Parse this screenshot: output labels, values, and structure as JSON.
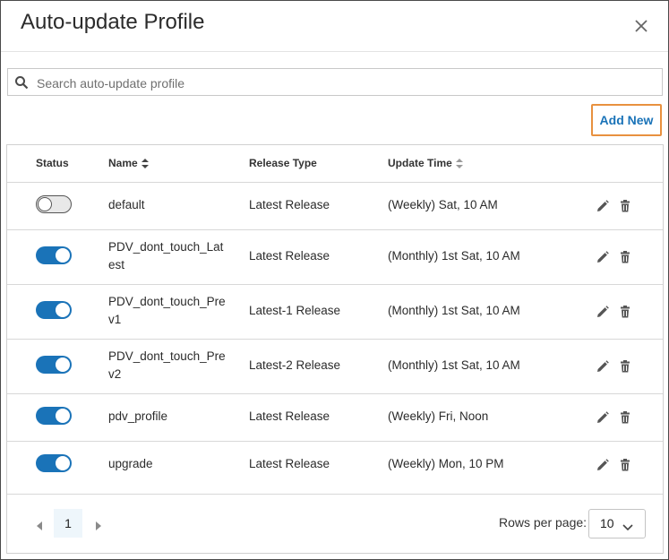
{
  "dialog": {
    "title": "Auto-update Profile"
  },
  "search": {
    "placeholder": "Search auto-update profile",
    "value": ""
  },
  "toolbar": {
    "add_new_label": "Add New"
  },
  "table": {
    "columns": {
      "status": "Status",
      "name": "Name",
      "release_type": "Release Type",
      "update_time": "Update Time"
    },
    "rows": [
      {
        "enabled": false,
        "name_line1": "default",
        "name_line2": "",
        "release_type": "Latest Release",
        "update_time": "(Weekly) Sat, 10 AM"
      },
      {
        "enabled": true,
        "name_line1": "PDV_dont_touch_Lat",
        "name_line2": "est",
        "release_type": "Latest Release",
        "update_time": "(Monthly) 1st Sat, 10 AM"
      },
      {
        "enabled": true,
        "name_line1": "PDV_dont_touch_Pre",
        "name_line2": "v1",
        "release_type": "Latest-1 Release",
        "update_time": "(Monthly) 1st Sat, 10 AM"
      },
      {
        "enabled": true,
        "name_line1": "PDV_dont_touch_Pre",
        "name_line2": "v2",
        "release_type": "Latest-2 Release",
        "update_time": "(Monthly) 1st Sat, 10 AM"
      },
      {
        "enabled": true,
        "name_line1": "pdv_profile",
        "name_line2": "",
        "release_type": "Latest Release",
        "update_time": "(Weekly) Fri, Noon"
      },
      {
        "enabled": true,
        "name_line1": "upgrade",
        "name_line2": "",
        "release_type": "Latest Release",
        "update_time": "(Weekly) Mon, 10 PM"
      }
    ]
  },
  "pagination": {
    "current_page": "1",
    "rows_per_page_label": "Rows per page:",
    "rows_per_page_value": "10"
  },
  "icons": {
    "close": "close-icon",
    "search": "search-icon",
    "sort": "sort-icon",
    "edit": "pencil-icon",
    "delete": "trash-icon",
    "prev": "chevron-left-icon",
    "next": "chevron-right-icon",
    "dropdown": "chevron-down-icon"
  },
  "colors": {
    "accent": "#1a73b8",
    "highlight_border": "#e8913f",
    "toggle_off": "#e8e8e8",
    "page_active_bg": "#eef6fb"
  }
}
